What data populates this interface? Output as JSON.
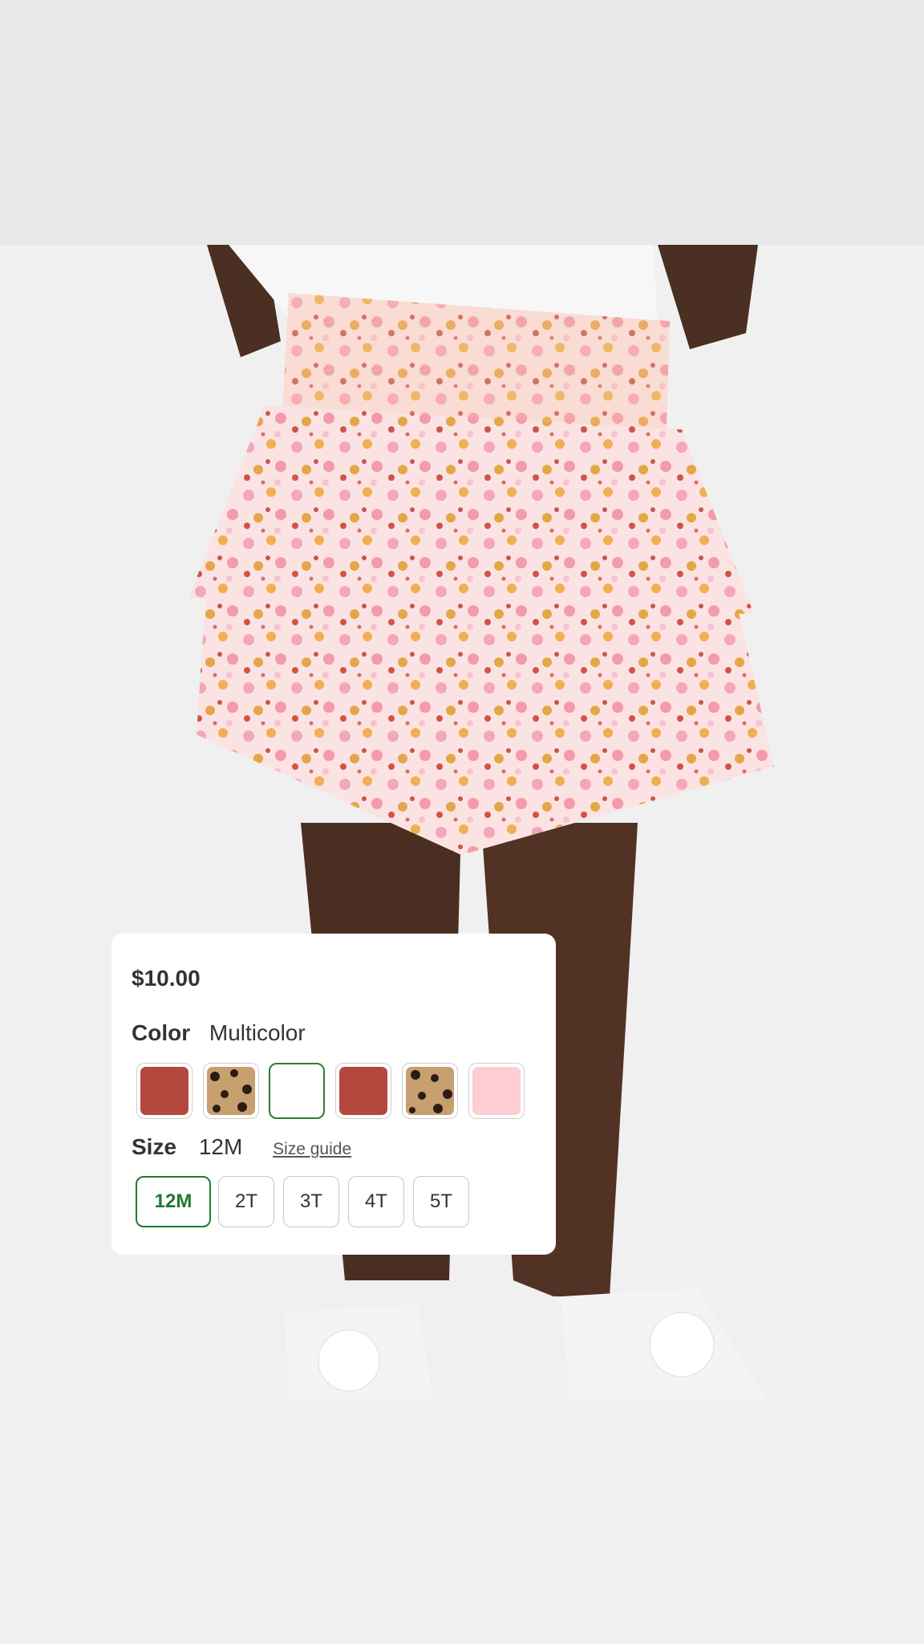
{
  "product": {
    "price": "$10.00",
    "color_label": "Color",
    "color_value": "Multicolor",
    "swatches": [
      {
        "name": "red",
        "color": "#b5483e"
      },
      {
        "name": "leopard",
        "color": "#c8a070"
      },
      {
        "name": "white",
        "color": "#ffffff"
      },
      {
        "name": "red",
        "color": "#b5483e"
      },
      {
        "name": "leopard",
        "color": "#c8a070"
      },
      {
        "name": "pink",
        "color": "#fccdd3"
      }
    ],
    "size_label": "Size",
    "size_value": "12M",
    "size_guide": "Size guide",
    "sizes": [
      "12M",
      "2T",
      "3T",
      "4T",
      "5T"
    ],
    "selected_size": "12M",
    "accent": "#1f7a2e"
  }
}
